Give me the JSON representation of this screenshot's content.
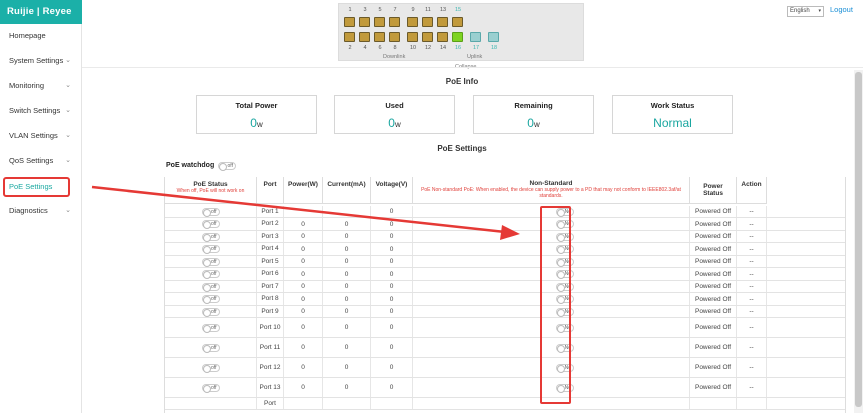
{
  "brand": {
    "logo_text": "Ruijie | Reyee",
    "accent": "#1bb0a8"
  },
  "sidebar": {
    "items": [
      {
        "label": "Homepage",
        "chevron": false
      },
      {
        "label": "System Settings",
        "chevron": true
      },
      {
        "label": "Monitoring",
        "chevron": true
      },
      {
        "label": "Switch Settings",
        "chevron": true
      },
      {
        "label": "VLAN Settings",
        "chevron": true
      },
      {
        "label": "QoS Settings",
        "chevron": true
      },
      {
        "label": "PoE Settings",
        "chevron": false,
        "active": true
      },
      {
        "label": "Diagnostics",
        "chevron": true
      }
    ]
  },
  "header": {
    "language": "English",
    "logout": "Logout"
  },
  "panel": {
    "top_numbers": [
      "1",
      "3",
      "5",
      "7",
      "9",
      "11",
      "13",
      "15"
    ],
    "bottom_numbers": [
      "2",
      "4",
      "6",
      "8",
      "10",
      "12",
      "14",
      "16",
      "17",
      "18"
    ],
    "downlink_label": "Downlink",
    "uplink_label": "Uplink",
    "collapse_label": "Collapse"
  },
  "poe_info": {
    "title": "PoE Info",
    "cards": [
      {
        "title": "Total Power",
        "value": "0",
        "unit": "w"
      },
      {
        "title": "Used",
        "value": "0",
        "unit": "w"
      },
      {
        "title": "Remaining",
        "value": "0",
        "unit": "w"
      },
      {
        "title": "Work Status",
        "value": "Normal",
        "unit": ""
      }
    ]
  },
  "poe_settings": {
    "title": "PoE Settings",
    "watchdog_label": "PoE watchdog",
    "watchdog_state": "off",
    "columns": {
      "status": "PoE Status",
      "status_note": "When off, PoE will not work on",
      "port": "Port",
      "power": "Power(W)",
      "current": "Current(mA)",
      "voltage": "Voltage(V)",
      "nonstd": "Non-Standard",
      "nonstd_note": "PoE Non-standard PoE: When enabled, the device can supply power to a PD that may not conform to IEEE802.3af/at standards.",
      "power_status": "Power Status",
      "action": "Action"
    },
    "rows": [
      {
        "state": "off",
        "port": "Port 1",
        "power": "",
        "current": "",
        "voltage": "0",
        "nonstd": "No",
        "pstatus": "Powered Off",
        "action": "--"
      },
      {
        "state": "off",
        "port": "Port 2",
        "power": "0",
        "current": "0",
        "voltage": "0",
        "nonstd": "No",
        "pstatus": "Powered Off",
        "action": "--"
      },
      {
        "state": "off",
        "port": "Port 3",
        "power": "0",
        "current": "0",
        "voltage": "0",
        "nonstd": "No",
        "pstatus": "Powered Off",
        "action": "--"
      },
      {
        "state": "off",
        "port": "Port 4",
        "power": "0",
        "current": "0",
        "voltage": "0",
        "nonstd": "No",
        "pstatus": "Powered Off",
        "action": "--"
      },
      {
        "state": "off",
        "port": "Port 5",
        "power": "0",
        "current": "0",
        "voltage": "0",
        "nonstd": "No",
        "pstatus": "Powered Off",
        "action": "--"
      },
      {
        "state": "off",
        "port": "Port 6",
        "power": "0",
        "current": "0",
        "voltage": "0",
        "nonstd": "No",
        "pstatus": "Powered Off",
        "action": "--"
      },
      {
        "state": "off",
        "port": "Port 7",
        "power": "0",
        "current": "0",
        "voltage": "0",
        "nonstd": "No",
        "pstatus": "Powered Off",
        "action": "--"
      },
      {
        "state": "off",
        "port": "Port 8",
        "power": "0",
        "current": "0",
        "voltage": "0",
        "nonstd": "No",
        "pstatus": "Powered Off",
        "action": "--"
      },
      {
        "state": "off",
        "port": "Port 9",
        "power": "0",
        "current": "0",
        "voltage": "0",
        "nonstd": "No",
        "pstatus": "Powered Off",
        "action": "--"
      },
      {
        "state": "off",
        "port": "Port 10",
        "power": "0",
        "current": "0",
        "voltage": "0",
        "nonstd": "No",
        "pstatus": "Powered Off",
        "action": "--"
      },
      {
        "state": "off",
        "port": "Port 11",
        "power": "0",
        "current": "0",
        "voltage": "0",
        "nonstd": "No",
        "pstatus": "Powered Off",
        "action": "--"
      },
      {
        "state": "off",
        "port": "Port 12",
        "power": "0",
        "current": "0",
        "voltage": "0",
        "nonstd": "No",
        "pstatus": "Powered Off",
        "action": "--"
      },
      {
        "state": "off",
        "port": "Port 13",
        "power": "0",
        "current": "0",
        "voltage": "0",
        "nonstd": "No",
        "pstatus": "Powered Off",
        "action": "--"
      },
      {
        "state": "",
        "port": "Port",
        "power": "",
        "current": "",
        "voltage": "",
        "nonstd": "",
        "pstatus": "",
        "action": ""
      }
    ]
  }
}
